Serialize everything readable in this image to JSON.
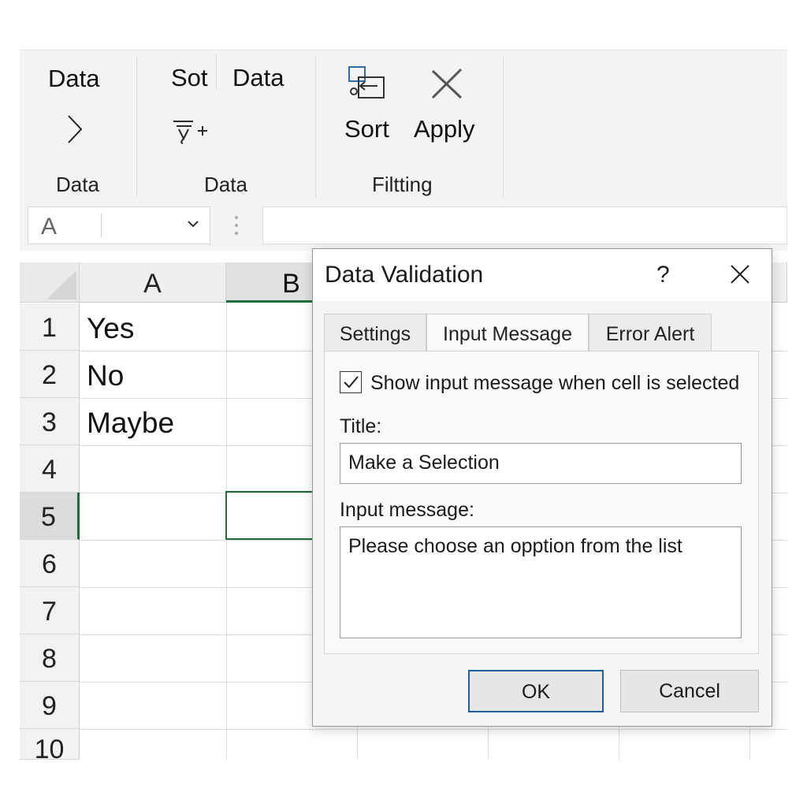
{
  "ribbon": {
    "group1": {
      "button_label": "Data",
      "label": "Data"
    },
    "group2": {
      "sort_label": "Sot",
      "data_label": "Data",
      "label": "Data"
    },
    "group3": {
      "sort_label": "Sort",
      "apply_label": "Apply",
      "label": "Filtting"
    },
    "icons": [
      "chevron-right-icon",
      "sort-filter-icon",
      "sort-icon",
      "clear-filter-icon"
    ]
  },
  "formula_bar": {
    "name_box_value": "A",
    "formula_value": ""
  },
  "sheet": {
    "columns": [
      "A",
      "B"
    ],
    "active_column": "B",
    "rows": [
      "1",
      "2",
      "3",
      "4",
      "5",
      "6",
      "7",
      "8",
      "9",
      "10"
    ],
    "active_row": "5",
    "cells": [
      "Yes",
      "No",
      "Maybe"
    ],
    "selected_cell": "B5",
    "accent_color": "#1e6e3c"
  },
  "dialog": {
    "title": "Data Validation",
    "help_label": "?",
    "tabs": [
      "Settings",
      "Input Message",
      "Error Alert"
    ],
    "active_tab": "Input Message",
    "show_message": {
      "label": "Show input message when cell is selected",
      "checked": true
    },
    "title_field": {
      "label": "Title:",
      "value": "Make a Selection"
    },
    "message_field": {
      "label": "Input message:",
      "value": "Please choose  an opption from the list"
    },
    "ok_label": "OK",
    "cancel_label": "Cancel"
  }
}
